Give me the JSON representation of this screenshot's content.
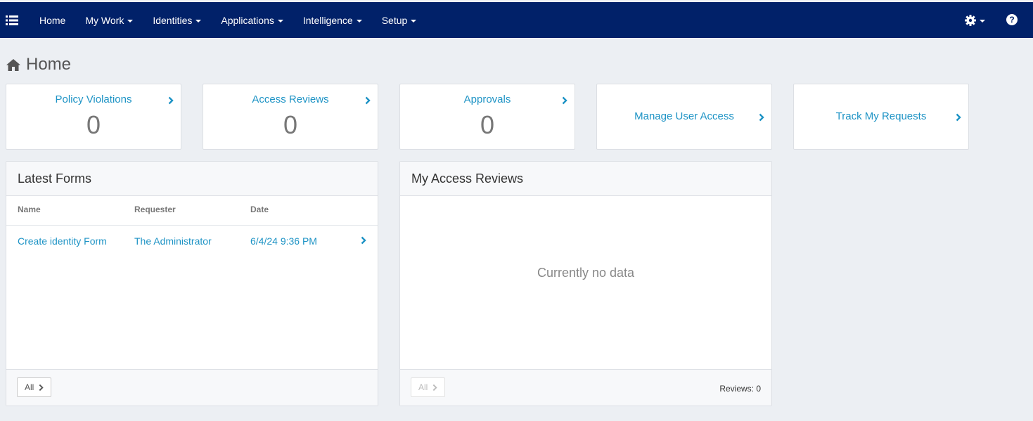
{
  "nav": {
    "items": [
      {
        "label": "Home",
        "dropdown": false
      },
      {
        "label": "My Work",
        "dropdown": true
      },
      {
        "label": "Identities",
        "dropdown": true
      },
      {
        "label": "Applications",
        "dropdown": true
      },
      {
        "label": "Intelligence",
        "dropdown": true
      },
      {
        "label": "Setup",
        "dropdown": true
      }
    ],
    "help_glyph": "?"
  },
  "page": {
    "title": "Home",
    "icon": "home-icon"
  },
  "tiles": {
    "policy_violations": {
      "title": "Policy Violations",
      "count": "0"
    },
    "access_reviews": {
      "title": "Access Reviews",
      "count": "0"
    },
    "approvals": {
      "title": "Approvals",
      "count": "0"
    },
    "manage_user_access": {
      "title": "Manage User Access"
    },
    "track_my_requests": {
      "title": "Track My Requests"
    }
  },
  "latest_forms": {
    "title": "Latest Forms",
    "columns": {
      "name": "Name",
      "requester": "Requester",
      "date": "Date"
    },
    "rows": [
      {
        "name": "Create identity Form",
        "requester": "The Administrator",
        "date": "6/4/24 9:36 PM"
      }
    ],
    "all_label": "All"
  },
  "my_access_reviews": {
    "title": "My Access Reviews",
    "empty_text": "Currently no data",
    "all_label": "All",
    "reviews_count": "Reviews: 0"
  },
  "colors": {
    "nav_bg": "#012169",
    "link": "#1d93c5",
    "page_bg": "#eceff3"
  }
}
